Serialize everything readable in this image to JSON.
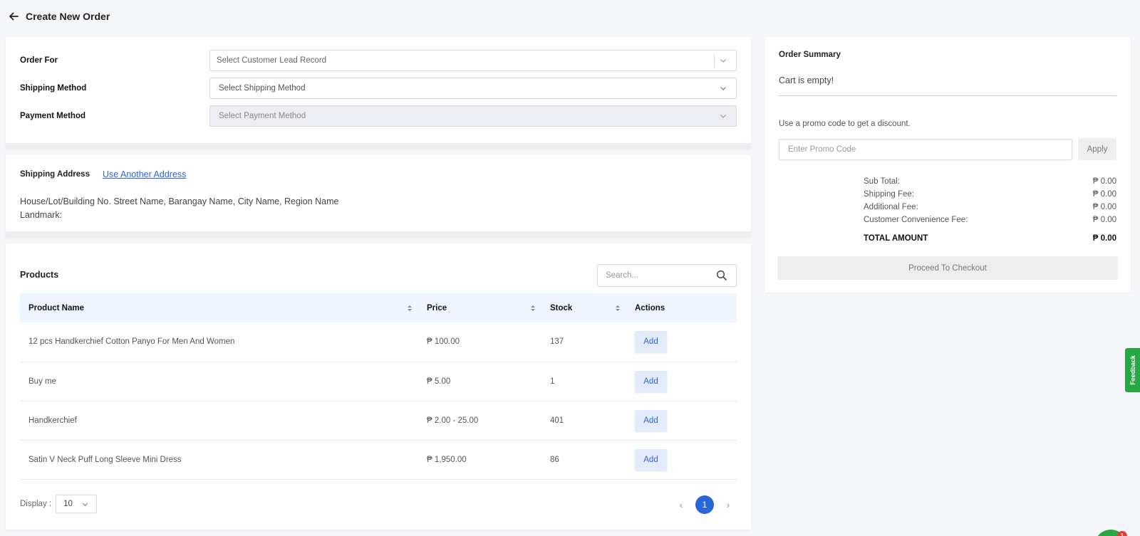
{
  "header": {
    "title": "Create New Order"
  },
  "order_form": {
    "order_for_label": "Order For",
    "order_for_placeholder": "Select Customer Lead Record",
    "shipping_method_label": "Shipping Method",
    "shipping_method_placeholder": "Select Shipping Method",
    "payment_method_label": "Payment Method",
    "payment_method_placeholder": "Select Payment Method"
  },
  "address": {
    "label": "Shipping Address",
    "link": "Use Another Address",
    "line1": "House/Lot/Building No. Street Name, Barangay Name, City Name, Region Name",
    "line2": "Landmark:"
  },
  "products": {
    "title": "Products",
    "search_placeholder": "Search...",
    "columns": [
      "Product Name",
      "Price",
      "Stock",
      "Actions"
    ],
    "rows": [
      {
        "name": "12 pcs Handkerchief Cotton Panyo For Men And Women",
        "price": "₱ 100.00",
        "stock": "137",
        "action": "Add"
      },
      {
        "name": "Buy me",
        "price": "₱ 5.00",
        "stock": "1",
        "action": "Add"
      },
      {
        "name": "Handkerchief",
        "price": "₱ 2.00 - 25.00",
        "stock": "401",
        "action": "Add"
      },
      {
        "name": "Satin V Neck Puff Long Sleeve Mini Dress",
        "price": "₱ 1,950.00",
        "stock": "86",
        "action": "Add"
      }
    ],
    "display_label": "Display :",
    "display_value": "10",
    "current_page": "1"
  },
  "summary": {
    "title": "Order Summary",
    "empty_text": "Cart is empty!",
    "promo_hint": "Use a promo code to get a discount.",
    "promo_placeholder": "Enter Promo Code",
    "apply_label": "Apply",
    "fees": [
      {
        "label": "Sub Total:",
        "value": "₱ 0.00"
      },
      {
        "label": "Shipping Fee:",
        "value": "₱ 0.00"
      },
      {
        "label": "Additional Fee:",
        "value": "₱ 0.00"
      },
      {
        "label": "Customer Convenience Fee:",
        "value": "₱ 0.00"
      }
    ],
    "total_label": "TOTAL AMOUNT",
    "total_value": "₱ 0.00",
    "checkout_label": "Proceed To Checkout"
  },
  "feedback_label": "Feedback",
  "chat_badge": "1",
  "colors": {
    "accent": "#2a66d8",
    "feedback": "#27a844",
    "page_bg": "#f6f7fb"
  }
}
